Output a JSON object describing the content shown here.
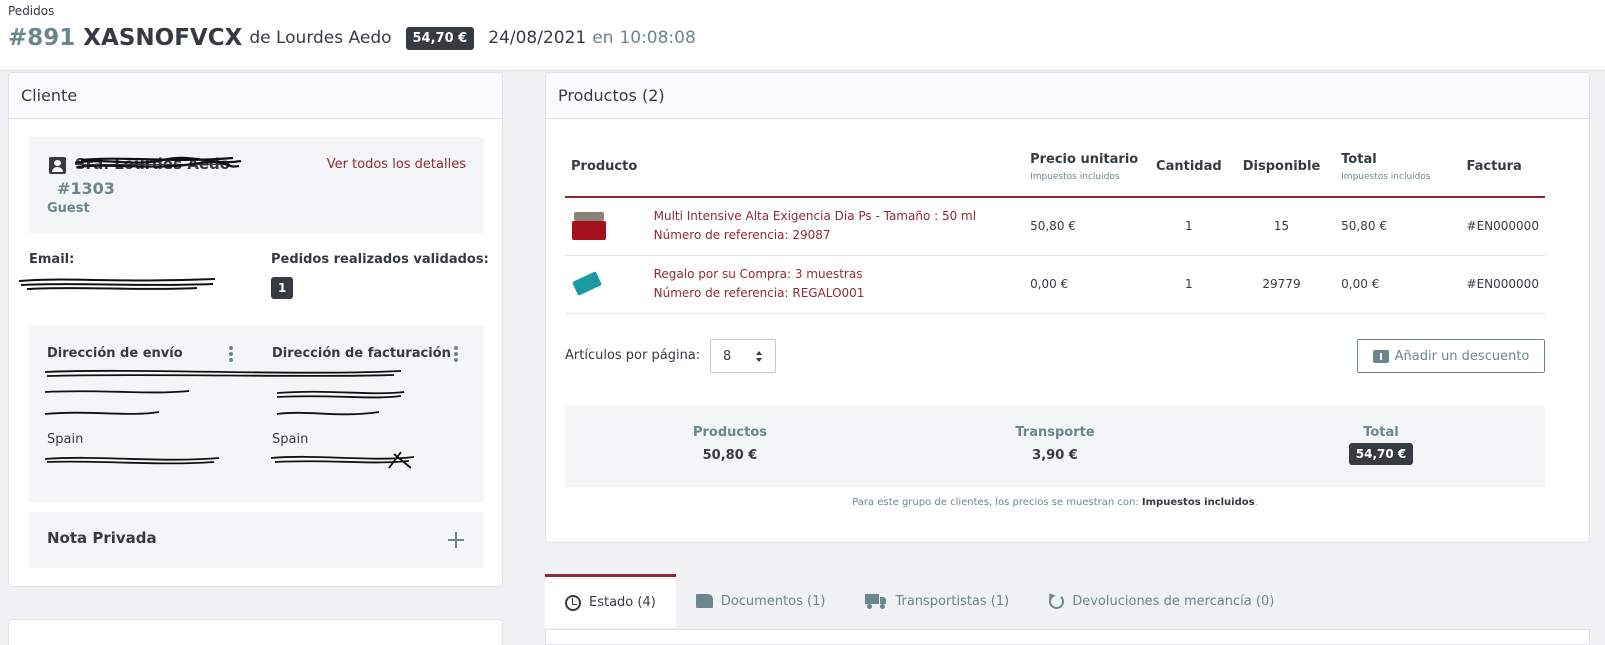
{
  "breadcrumb": "Pedidos",
  "order": {
    "number": "#891",
    "reference": "XASNOFVCX",
    "by_text": "de Lourdes Aedo",
    "total_badge": "54,70 €",
    "date": "24/08/2021",
    "at_word": "en",
    "time": "10:08:08"
  },
  "customer_card": {
    "title": "Cliente",
    "name": "Sra. Lourdes Aedo",
    "id": "#1303",
    "type": "Guest",
    "details_link": "Ver todos los detalles",
    "email_label": "Email:",
    "orders_label": "Pedidos realizados validados:",
    "orders_count": "1",
    "shipping_label": "Dirección de envío",
    "billing_label": "Dirección de facturación",
    "shipping_country": "Spain",
    "billing_country": "Spain",
    "private_note_label": "Nota Privada"
  },
  "products_card": {
    "title": "Productos (2)",
    "columns": {
      "product": "Producto",
      "unit_price": "Precio unitario",
      "unit_price_sub": "Impuestos incluidos",
      "quantity": "Cantidad",
      "available": "Disponible",
      "total": "Total",
      "total_sub": "Impuestos incluidos",
      "invoice": "Factura"
    },
    "rows": [
      {
        "name": "Multi Intensive Alta Exigencia Dia Ps - Tamaño : 50 ml",
        "ref": "Número de referencia: 29087",
        "unit_price": "50,80 €",
        "quantity": "1",
        "available": "15",
        "total": "50,80 €",
        "invoice": "#EN000000"
      },
      {
        "name": "Regalo por su Compra: 3 muestras",
        "ref": "Número de referencia: REGALO001",
        "unit_price": "0,00 €",
        "quantity": "1",
        "available": "29779",
        "total": "0,00 €",
        "invoice": "#EN000000"
      }
    ],
    "per_page_label": "Artículos por página:",
    "per_page_value": "8",
    "discount_button": "Añadir un descuento",
    "totals": {
      "products_label": "Productos",
      "products_value": "50,80 €",
      "shipping_label": "Transporte",
      "shipping_value": "3,90 €",
      "total_label": "Total",
      "total_value": "54,70 €"
    },
    "tax_note_prefix": "Para este grupo de clientes, los precios se muestran con:",
    "tax_note_bold": "Impuestos incluidos",
    "tax_note_suffix": "."
  },
  "tabs": [
    {
      "label": "Estado (4)",
      "icon": "history-icon",
      "active": true
    },
    {
      "label": "Documentos (1)",
      "icon": "document-icon",
      "active": false
    },
    {
      "label": "Transportistas (1)",
      "icon": "truck-icon",
      "active": false
    },
    {
      "label": "Devoluciones de mercancía (0)",
      "icon": "undo-icon",
      "active": false
    }
  ],
  "colors": {
    "accent": "#8f2a35",
    "badge_bg": "#363a41",
    "muted": "#6c868e"
  }
}
